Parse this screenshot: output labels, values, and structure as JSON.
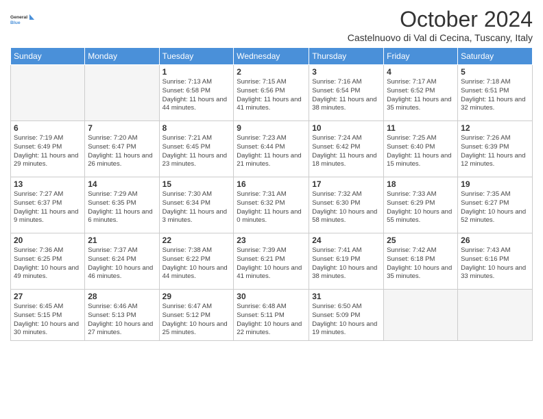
{
  "header": {
    "logo_line1": "General",
    "logo_line2": "Blue",
    "month_title": "October 2024",
    "subtitle": "Castelnuovo di Val di Cecina, Tuscany, Italy"
  },
  "days_of_week": [
    "Sunday",
    "Monday",
    "Tuesday",
    "Wednesday",
    "Thursday",
    "Friday",
    "Saturday"
  ],
  "weeks": [
    [
      {
        "day": "",
        "info": ""
      },
      {
        "day": "",
        "info": ""
      },
      {
        "day": "1",
        "info": "Sunrise: 7:13 AM\nSunset: 6:58 PM\nDaylight: 11 hours and 44 minutes."
      },
      {
        "day": "2",
        "info": "Sunrise: 7:15 AM\nSunset: 6:56 PM\nDaylight: 11 hours and 41 minutes."
      },
      {
        "day": "3",
        "info": "Sunrise: 7:16 AM\nSunset: 6:54 PM\nDaylight: 11 hours and 38 minutes."
      },
      {
        "day": "4",
        "info": "Sunrise: 7:17 AM\nSunset: 6:52 PM\nDaylight: 11 hours and 35 minutes."
      },
      {
        "day": "5",
        "info": "Sunrise: 7:18 AM\nSunset: 6:51 PM\nDaylight: 11 hours and 32 minutes."
      }
    ],
    [
      {
        "day": "6",
        "info": "Sunrise: 7:19 AM\nSunset: 6:49 PM\nDaylight: 11 hours and 29 minutes."
      },
      {
        "day": "7",
        "info": "Sunrise: 7:20 AM\nSunset: 6:47 PM\nDaylight: 11 hours and 26 minutes."
      },
      {
        "day": "8",
        "info": "Sunrise: 7:21 AM\nSunset: 6:45 PM\nDaylight: 11 hours and 23 minutes."
      },
      {
        "day": "9",
        "info": "Sunrise: 7:23 AM\nSunset: 6:44 PM\nDaylight: 11 hours and 21 minutes."
      },
      {
        "day": "10",
        "info": "Sunrise: 7:24 AM\nSunset: 6:42 PM\nDaylight: 11 hours and 18 minutes."
      },
      {
        "day": "11",
        "info": "Sunrise: 7:25 AM\nSunset: 6:40 PM\nDaylight: 11 hours and 15 minutes."
      },
      {
        "day": "12",
        "info": "Sunrise: 7:26 AM\nSunset: 6:39 PM\nDaylight: 11 hours and 12 minutes."
      }
    ],
    [
      {
        "day": "13",
        "info": "Sunrise: 7:27 AM\nSunset: 6:37 PM\nDaylight: 11 hours and 9 minutes."
      },
      {
        "day": "14",
        "info": "Sunrise: 7:29 AM\nSunset: 6:35 PM\nDaylight: 11 hours and 6 minutes."
      },
      {
        "day": "15",
        "info": "Sunrise: 7:30 AM\nSunset: 6:34 PM\nDaylight: 11 hours and 3 minutes."
      },
      {
        "day": "16",
        "info": "Sunrise: 7:31 AM\nSunset: 6:32 PM\nDaylight: 11 hours and 0 minutes."
      },
      {
        "day": "17",
        "info": "Sunrise: 7:32 AM\nSunset: 6:30 PM\nDaylight: 10 hours and 58 minutes."
      },
      {
        "day": "18",
        "info": "Sunrise: 7:33 AM\nSunset: 6:29 PM\nDaylight: 10 hours and 55 minutes."
      },
      {
        "day": "19",
        "info": "Sunrise: 7:35 AM\nSunset: 6:27 PM\nDaylight: 10 hours and 52 minutes."
      }
    ],
    [
      {
        "day": "20",
        "info": "Sunrise: 7:36 AM\nSunset: 6:25 PM\nDaylight: 10 hours and 49 minutes."
      },
      {
        "day": "21",
        "info": "Sunrise: 7:37 AM\nSunset: 6:24 PM\nDaylight: 10 hours and 46 minutes."
      },
      {
        "day": "22",
        "info": "Sunrise: 7:38 AM\nSunset: 6:22 PM\nDaylight: 10 hours and 44 minutes."
      },
      {
        "day": "23",
        "info": "Sunrise: 7:39 AM\nSunset: 6:21 PM\nDaylight: 10 hours and 41 minutes."
      },
      {
        "day": "24",
        "info": "Sunrise: 7:41 AM\nSunset: 6:19 PM\nDaylight: 10 hours and 38 minutes."
      },
      {
        "day": "25",
        "info": "Sunrise: 7:42 AM\nSunset: 6:18 PM\nDaylight: 10 hours and 35 minutes."
      },
      {
        "day": "26",
        "info": "Sunrise: 7:43 AM\nSunset: 6:16 PM\nDaylight: 10 hours and 33 minutes."
      }
    ],
    [
      {
        "day": "27",
        "info": "Sunrise: 6:45 AM\nSunset: 5:15 PM\nDaylight: 10 hours and 30 minutes."
      },
      {
        "day": "28",
        "info": "Sunrise: 6:46 AM\nSunset: 5:13 PM\nDaylight: 10 hours and 27 minutes."
      },
      {
        "day": "29",
        "info": "Sunrise: 6:47 AM\nSunset: 5:12 PM\nDaylight: 10 hours and 25 minutes."
      },
      {
        "day": "30",
        "info": "Sunrise: 6:48 AM\nSunset: 5:11 PM\nDaylight: 10 hours and 22 minutes."
      },
      {
        "day": "31",
        "info": "Sunrise: 6:50 AM\nSunset: 5:09 PM\nDaylight: 10 hours and 19 minutes."
      },
      {
        "day": "",
        "info": ""
      },
      {
        "day": "",
        "info": ""
      }
    ]
  ]
}
